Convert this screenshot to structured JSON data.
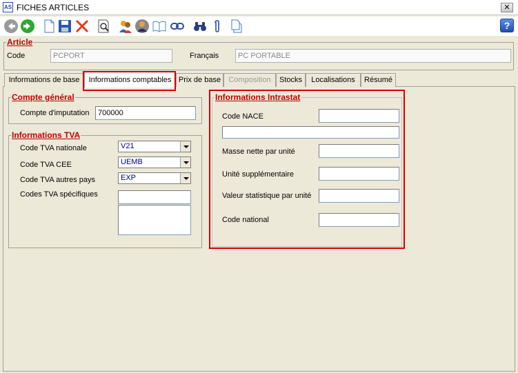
{
  "window": {
    "title": "FICHES ARTICLES",
    "close_label": "✕"
  },
  "toolbar": {
    "buttons": [
      "back-icon",
      "forward-icon",
      "new-document-icon",
      "save-icon",
      "delete-icon",
      "preview-icon",
      "users-icon",
      "contact-icon",
      "book-icon",
      "link-icon",
      "binoculars-icon",
      "paperclip-icon",
      "copy-icon"
    ],
    "help_label": "?"
  },
  "article": {
    "legend": "Article",
    "code_label": "Code",
    "code_value": "PCPORT",
    "lang_label": "Français",
    "lang_value": "PC PORTABLE"
  },
  "tabs": [
    {
      "label": "Informations de base",
      "active": false
    },
    {
      "label": "Informations comptables",
      "active": true
    },
    {
      "label": "Prix de base",
      "active": false
    },
    {
      "label": "Composition",
      "active": false,
      "disabled": true
    },
    {
      "label": "Stocks",
      "active": false
    },
    {
      "label": "Localisations",
      "active": false
    },
    {
      "label": "Résumé",
      "active": false
    }
  ],
  "compte_general": {
    "legend": "Compte général",
    "imputation_label": "Compte d'imputation",
    "imputation_value": "700000"
  },
  "tva": {
    "legend": "Informations TVA",
    "nationale_label": "Code TVA nationale",
    "nationale_value": "V21",
    "cee_label": "Code TVA CEE",
    "cee_value": "UEMB",
    "autres_label": "Code TVA autres pays",
    "autres_value": "EXP",
    "specifiques_label": "Codes TVA spécifiques",
    "specifiques_value": ""
  },
  "intrastat": {
    "legend": "Informations Intrastat",
    "nace_label": "Code NACE",
    "nace_value": "",
    "nace_desc_value": "",
    "masse_label": "Masse nette par unité",
    "masse_value": "",
    "unite_label": "Unité supplémentaire",
    "unite_value": "",
    "valeur_label": "Valeur statistique par unité",
    "valeur_value": "",
    "national_label": "Code national",
    "national_value": ""
  },
  "colors": {
    "accent_red": "#c00000",
    "highlight_red": "#d40000",
    "background": "#ece9d8"
  }
}
